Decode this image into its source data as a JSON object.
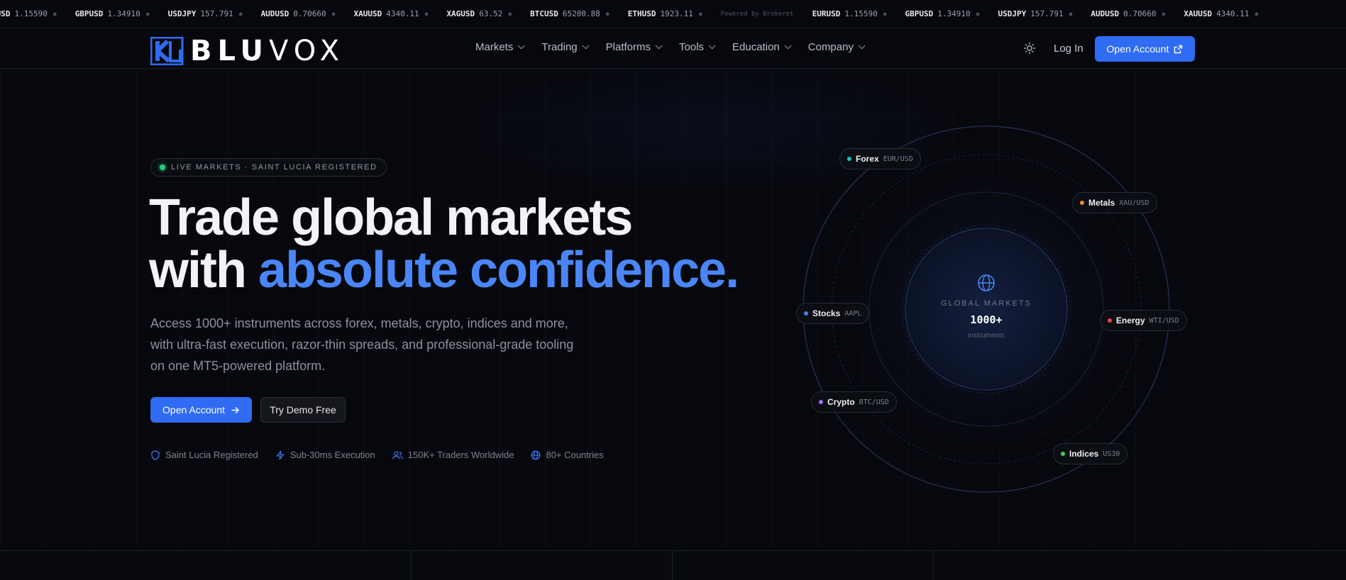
{
  "ticker": {
    "items": [
      {
        "symbol": "RUSD",
        "price": "1.15590"
      },
      {
        "symbol": "GBPUSD",
        "price": "1.34910"
      },
      {
        "symbol": "USDJPY",
        "price": "157.791"
      },
      {
        "symbol": "AUDUSD",
        "price": "0.70660"
      },
      {
        "symbol": "XAUUSD",
        "price": "4340.11"
      },
      {
        "symbol": "XAGUSD",
        "price": "63.52"
      },
      {
        "symbol": "BTCUSD",
        "price": "65200.88"
      },
      {
        "symbol": "ETHUSD",
        "price": "1923.11"
      }
    ],
    "powered_by": "Powered by Brokeret",
    "items_repeat": [
      {
        "symbol": "EURUSD",
        "price": "1.15590"
      },
      {
        "symbol": "GBPUSD",
        "price": "1.34910"
      },
      {
        "symbol": "USDJPY",
        "price": "157.791"
      },
      {
        "symbol": "AUDUSD",
        "price": "0.70660"
      },
      {
        "symbol": "XAUUSD",
        "price": "4340.11"
      }
    ]
  },
  "nav": {
    "logo_text": "BLUVOX",
    "logo_bold": "BLU",
    "logo_light": "VOX",
    "menu": [
      "Markets",
      "Trading",
      "Platforms",
      "Tools",
      "Education",
      "Company"
    ],
    "login": "Log In",
    "open_account": "Open Account"
  },
  "hero": {
    "badge": "LIVE MARKETS · SAINT LUCIA REGISTERED",
    "headline_line1": "Trade global markets",
    "headline_line2_prefix": "with ",
    "headline_line2_accent": "absolute confidence.",
    "subtitle": "Access 1000+ instruments across forex, metals, crypto, indices and more, with ultra-fast execution, razor-thin spreads, and professional-grade tooling on one MT5-powered platform.",
    "cta_primary": "Open Account",
    "cta_secondary": "Try Demo Free",
    "features": [
      "Saint Lucia Registered",
      "Sub-30ms Execution",
      "150K+ Traders Worldwide",
      "80+ Countries"
    ]
  },
  "orbit": {
    "core_label": "GLOBAL MARKETS",
    "core_count": "1000+",
    "core_unit": "instruments",
    "markets": [
      {
        "name": "Forex",
        "symbol": "EUR/USD",
        "color": "#17c3c3"
      },
      {
        "name": "Metals",
        "symbol": "XAU/USD",
        "color": "#f08a24"
      },
      {
        "name": "Stocks",
        "symbol": "AAPL",
        "color": "#4a7bf7"
      },
      {
        "name": "Energy",
        "symbol": "WTI/USD",
        "color": "#f04444"
      },
      {
        "name": "Crypto",
        "symbol": "BTC/USD",
        "color": "#a86ef7"
      },
      {
        "name": "Indices",
        "symbol": "US30",
        "color": "#3ccf5a"
      }
    ]
  },
  "colors": {
    "accent": "#2f6bf3",
    "accent_text": "#4a86f7",
    "live": "#1fcf7f",
    "background": "#07080d"
  }
}
